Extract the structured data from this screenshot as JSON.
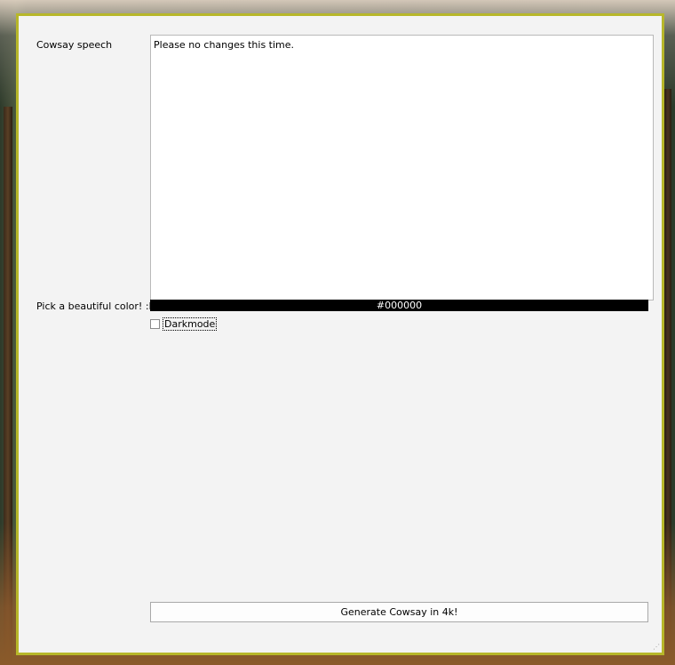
{
  "form": {
    "speech_label": "Cowsay speech",
    "speech_value": "Please no changes this time.",
    "color_label": "Pick a beautiful color! :D",
    "color_value": "#000000",
    "darkmode_label": "Darkmode",
    "darkmode_checked": false,
    "generate_label": "Generate Cowsay in 4k!"
  },
  "colors": {
    "window_border": "#b7b72a",
    "window_bg": "#f3f3f3",
    "color_button_bg": "#000000"
  },
  "icons": {
    "resize": "size-grip-icon"
  }
}
